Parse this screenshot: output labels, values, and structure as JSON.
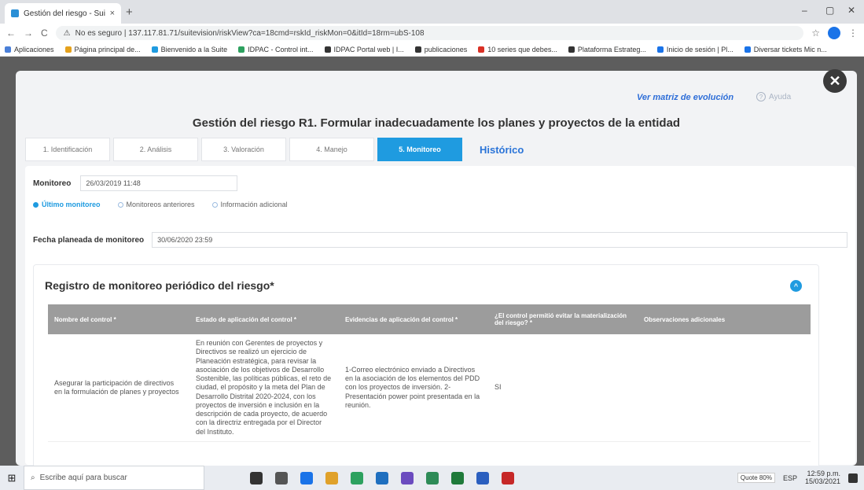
{
  "browser": {
    "tab_title": "Gestión del riesgo - Suite Visión",
    "tab_close": "×",
    "new_tab": "+",
    "url": "No es seguro | 137.117.81.71/suitevision/riskView?ca=18cmd=rskId_riskMon=0&itId=18rm=ubS-108",
    "back": "←",
    "forward": "→",
    "reload": "C",
    "star": "☆",
    "menu": "⋮",
    "win_min": "–",
    "win_max": "▢",
    "win_close": "✕",
    "bookmarks": [
      {
        "label": "Aplicaciones",
        "color": "#4a7fd8"
      },
      {
        "label": "Página principal de...",
        "color": "#e5a11c"
      },
      {
        "label": "Bienvenido a la Suite",
        "color": "#1f9be0"
      },
      {
        "label": "IDPAC - Control int...",
        "color": "#2da15f"
      },
      {
        "label": "IDPAC Portal web | I...",
        "color": "#333333"
      },
      {
        "label": "publicaciones",
        "color": "#333333"
      },
      {
        "label": "10 series que debes...",
        "color": "#d93025"
      },
      {
        "label": "Plataforma Estrateg...",
        "color": "#333333"
      },
      {
        "label": "Inicio de sesión | Pl...",
        "color": "#1a73e8"
      },
      {
        "label": "Diversar tickets Mic n...",
        "color": "#1a73e8"
      }
    ]
  },
  "modal": {
    "matriz_link": "Ver matriz de evolución",
    "ayuda": "Ayuda",
    "ayuda_icon": "?",
    "close": "✕",
    "title": "Gestión del riesgo R1. Formular inadecuadamente los planes y proyectos de la entidad",
    "steps": [
      {
        "label": "1. Identificación",
        "active": false
      },
      {
        "label": "2. Análisis",
        "active": false
      },
      {
        "label": "3. Valoración",
        "active": false
      },
      {
        "label": "4. Manejo",
        "active": false
      },
      {
        "label": "5. Monitoreo",
        "active": true
      }
    ],
    "historico": "Histórico"
  },
  "monitoreo": {
    "label": "Monitoreo",
    "value": "26/03/2019 11:48",
    "radios": [
      {
        "label": "Último monitoreo",
        "selected": true
      },
      {
        "label": "Monitoreos anteriores",
        "selected": false
      },
      {
        "label": "Información adicional",
        "selected": false
      }
    ],
    "fecha_label": "Fecha planeada de monitoreo",
    "fecha_value": "30/06/2020 23:59"
  },
  "registro": {
    "title": "Registro de monitoreo periódico del riesgo*",
    "toggle": "^",
    "headers": [
      "Nombre del control *",
      "Estado de aplicación del control *",
      "Evidencias de aplicación del control *",
      "¿El control permitió evitar la materialización del riesgo? *",
      "Observaciones adicionales"
    ],
    "rows": [
      {
        "nombre": "Asegurar la participación de directivos en la formulación de planes y proyectos",
        "estado": "En reunión con Gerentes de proyectos y Directivos se realizó un ejercicio de Planeación estratégica, para revisar la asociación de los objetivos de Desarrollo Sostenible, las políticas públicas, el reto de ciudad, el propósito y la meta del Plan de Desarrollo Distrital 2020-2024, con los proyectos de inversión e inclusión en la descripción de cada proyecto, de acuerdo con la directriz entregada por el Director del Instituto.",
        "evidencias": "1-Correo electrónico enviado a Directivos en la asociación de los elementos del PDD con los proyectos de inversión. 2-Presentación power point presentada en la reunión.",
        "evito": "SI",
        "observaciones": ""
      }
    ]
  },
  "taskbar": {
    "search_placeholder": "Escribe aquí para buscar",
    "start_icon": "⊞",
    "search_icon": "⌕",
    "tray_lang": "ESP",
    "time": "12:59 p.m.",
    "date": "15/03/2021",
    "tray_badge": "Quote 80%",
    "apps": [
      "#333333",
      "#555555",
      "#1a73e8",
      "#e0a12a",
      "#2da15f",
      "#1f6fbf",
      "#6b4bbf",
      "#2e8b57",
      "#1f7a3a",
      "#2b5fbf",
      "#c62828"
    ]
  }
}
